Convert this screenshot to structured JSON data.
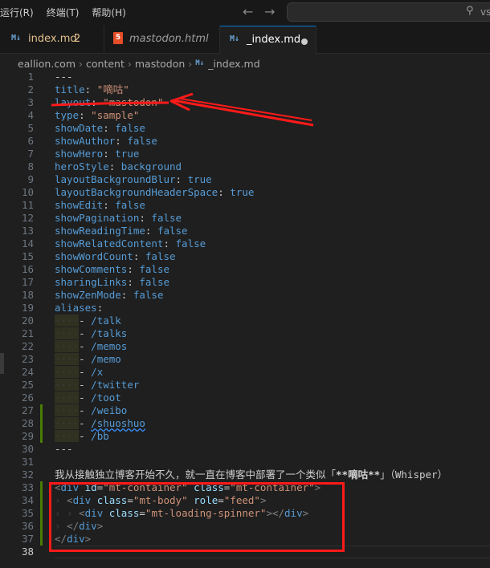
{
  "menu": [
    "运行(R)",
    "终端(T)",
    "帮助(H)"
  ],
  "command_center": {
    "text": "vsc"
  },
  "tabs": [
    {
      "label": "index.md",
      "badge": "2",
      "icon": "markdown-icon"
    },
    {
      "label": "mastodon.html",
      "icon": "html-icon"
    },
    {
      "label": "_index.md",
      "icon": "markdown-icon",
      "modified": true
    }
  ],
  "breadcrumb": [
    "eallion.com",
    "content",
    "mastodon",
    "_index.md"
  ],
  "editor": {
    "active_line": 38,
    "line_numbers": [
      "1",
      "2",
      "3",
      "4",
      "5",
      "6",
      "7",
      "8",
      "9",
      "10",
      "11",
      "12",
      "13",
      "14",
      "15",
      "16",
      "17",
      "18",
      "19",
      "20",
      "21",
      "22",
      "23",
      "24",
      "25",
      "26",
      "27",
      "28",
      "29",
      "30",
      "31",
      "32",
      "33",
      "34",
      "35",
      "36",
      "37",
      "38"
    ],
    "fm": {
      "l1": "---",
      "l2k": "title",
      "l2v": "\"嘀咕\"",
      "l3k": "layout",
      "l3v": "\"mastodon\"",
      "l4k": "type",
      "l4v": "\"sample\"",
      "l5k": "showDate",
      "l5v": "false",
      "l6k": "showAuthor",
      "l6v": "false",
      "l7k": "showHero",
      "l7v": "true",
      "l8k": "heroStyle",
      "l8v": "background",
      "l9k": "layoutBackgroundBlur",
      "l9v": "true",
      "l10k": "layoutBackgroundHeaderSpace",
      "l10v": "true",
      "l11k": "showEdit",
      "l11v": "false",
      "l12k": "showPagination",
      "l12v": "false",
      "l13k": "showReadingTime",
      "l13v": "false",
      "l14k": "showRelatedContent",
      "l14v": "false",
      "l15k": "showWordCount",
      "l15v": "false",
      "l16k": "showComments",
      "l16v": "false",
      "l17k": "sharingLinks",
      "l17v": "false",
      "l18k": "showZenMode",
      "l18v": "false",
      "l19k": "aliases",
      "aliases": [
        "/talk",
        "/talks",
        "/memos",
        "/memo",
        "/x",
        "/twitter",
        "/toot",
        "/weibo",
        "/shuoshuo",
        "/bb"
      ],
      "l30": "---"
    },
    "l32": {
      "pre": "我从接触独立博客开始不久，就一直在博客中部署了一个类似「",
      "bold": "**嘀咕**",
      "post": "」（Whisper）"
    },
    "html": {
      "l33_tag": "div",
      "l33_a1": "id",
      "l33_v1": "\"mt-container\"",
      "l33_a2": "class",
      "l33_v2": "\"mt-container\"",
      "l34_tag": "div",
      "l34_a1": "class",
      "l34_v1": "\"mt-body\"",
      "l34_a2": "role",
      "l34_v2": "\"feed\"",
      "l35_tag": "div",
      "l35_a1": "class",
      "l35_v1": "\"mt-loading-spinner\"",
      "l35_close": "div",
      "l36_close": "div",
      "l37_close": "div"
    }
  },
  "colors": {
    "annotation_red": "#ff1a1a",
    "accent": "#0078d4"
  }
}
